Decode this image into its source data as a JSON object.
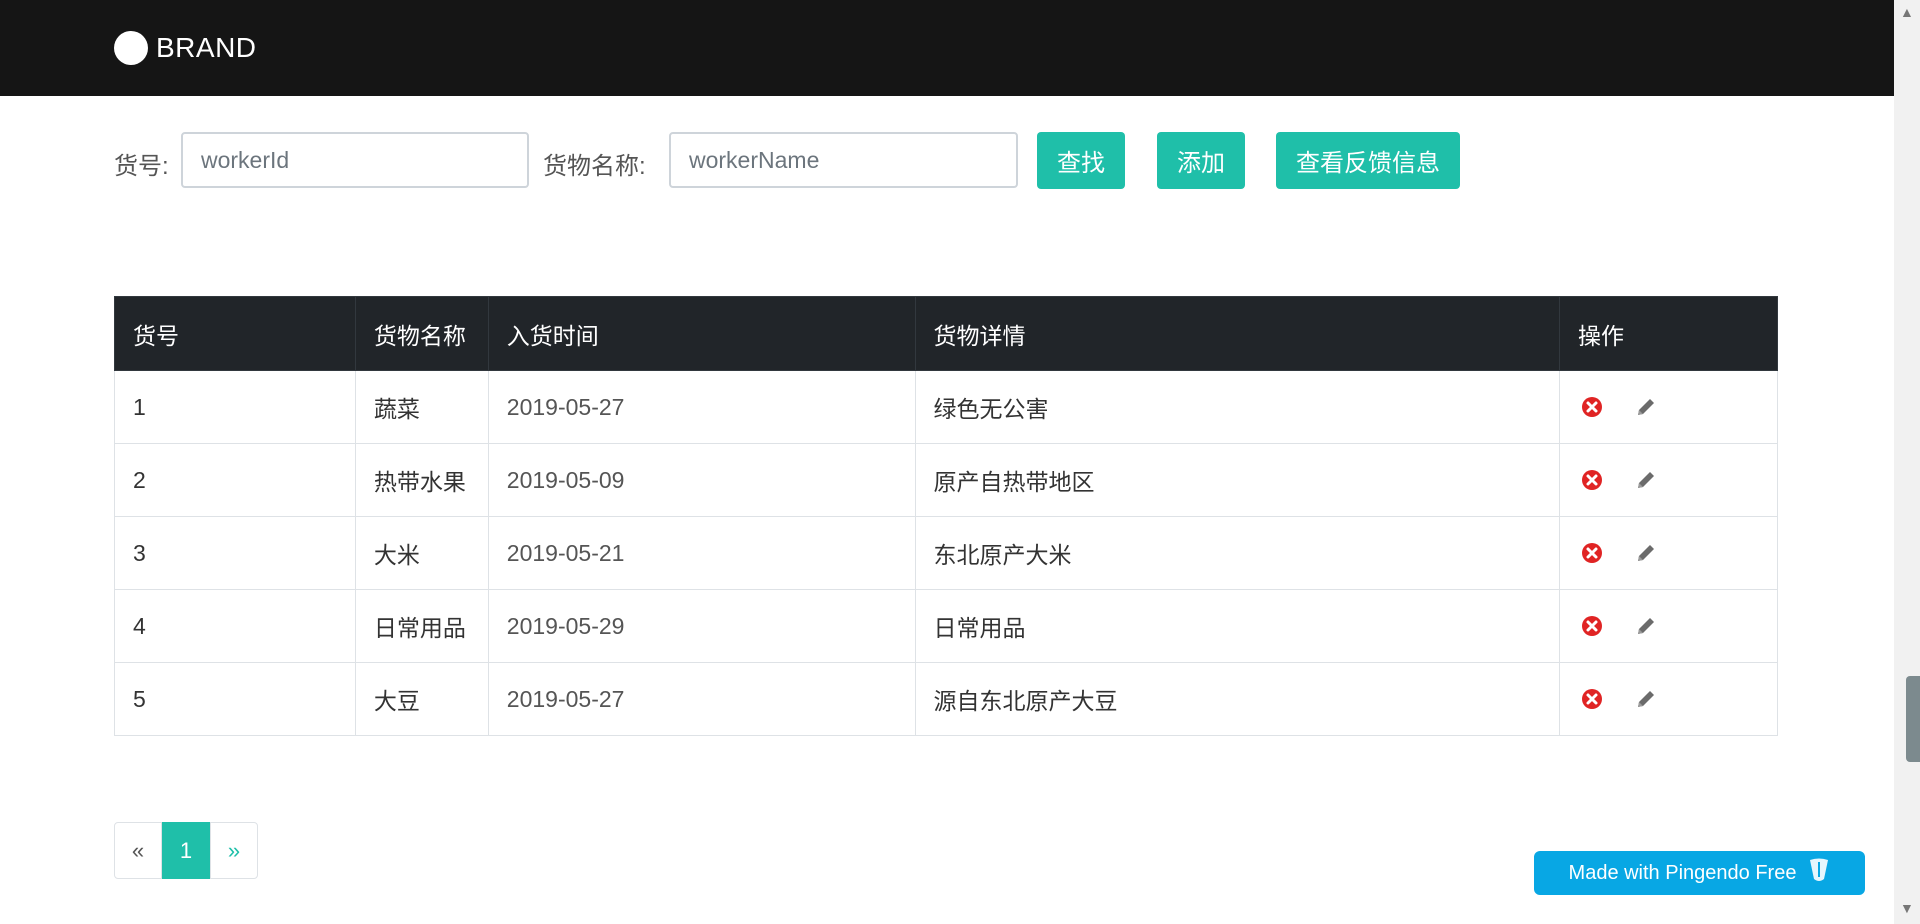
{
  "navbar": {
    "brand": "BRAND"
  },
  "search": {
    "id_label": "货号:",
    "id_placeholder": "workerId",
    "name_label": "货物名称:",
    "name_placeholder": "workerName",
    "find_button": "查找",
    "add_button": "添加",
    "feedback_button": "查看反馈信息"
  },
  "table": {
    "headers": [
      "货号",
      "货物名称",
      "入货时间",
      "货物详情",
      "操作"
    ],
    "rows": [
      {
        "id": "1",
        "name": "蔬菜",
        "date": "2019-05-27",
        "detail": "绿色无公害"
      },
      {
        "id": "2",
        "name": "热带水果",
        "date": "2019-05-09",
        "detail": "原产自热带地区"
      },
      {
        "id": "3",
        "name": "大米",
        "date": "2019-05-21",
        "detail": "东北原产大米"
      },
      {
        "id": "4",
        "name": "日常用品",
        "date": "2019-05-29",
        "detail": "日常用品"
      },
      {
        "id": "5",
        "name": "大豆",
        "date": "2019-05-27",
        "detail": "源自东北原产大豆"
      }
    ]
  },
  "icons": {
    "delete": "delete-circle-icon",
    "edit": "pencil-icon"
  },
  "pagination": {
    "prev": "«",
    "current": "1",
    "next": "»"
  },
  "badge": {
    "text": "Made with Pingendo Free"
  },
  "colors": {
    "accent": "#1fbfa9",
    "navbar": "#151515",
    "table_header": "#212529",
    "delete": "#e02424",
    "badge": "#08a7e4"
  }
}
